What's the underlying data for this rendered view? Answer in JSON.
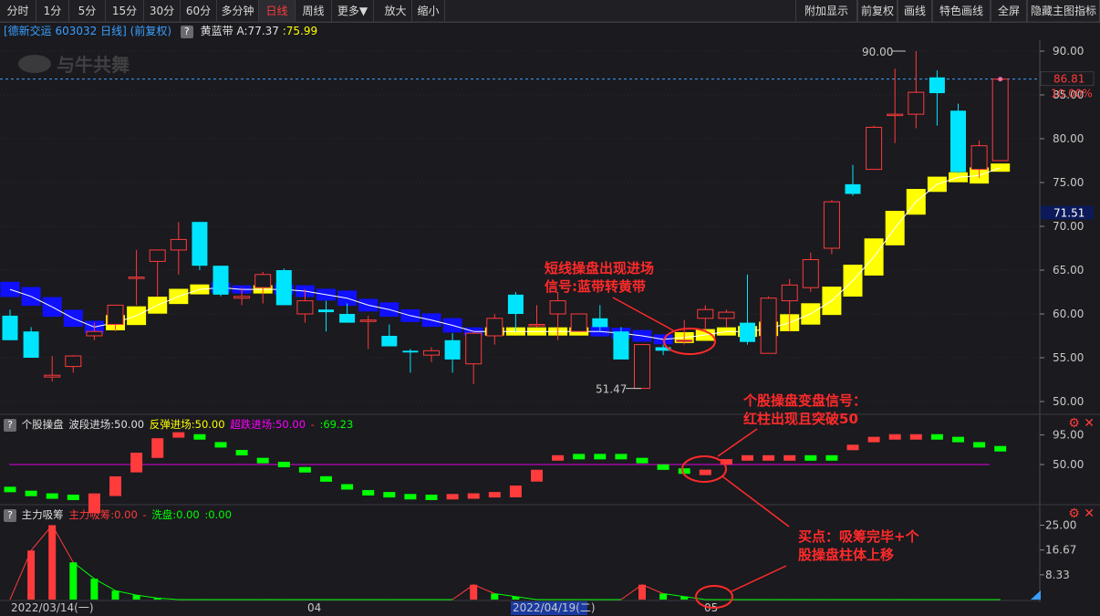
{
  "toolbar": {
    "left": [
      "分时",
      "1分",
      "5分",
      "15分",
      "30分",
      "60分",
      "多分钟",
      "日线",
      "周线",
      "更多▼",
      "放大",
      "缩小"
    ],
    "active": "日线",
    "right": [
      "附加显示",
      "前复权",
      "画线",
      "特色画线",
      "全屏",
      "隐藏主图指标"
    ]
  },
  "infobar": {
    "stock": "[德新交运 603032 日线]",
    "adj": "(前复权)",
    "q": "?",
    "indicator": "黄蓝带",
    "a_label": "A:77.37",
    "b_label": ":75.99"
  },
  "price_axis": {
    "ticks": [
      "90.00",
      "85.00",
      "80.00",
      "75.00",
      "70.00",
      "65.00",
      "60.00",
      "55.00",
      "50.00"
    ],
    "current": "86.81",
    "pct": "10.00%",
    "ma": "71.51"
  },
  "price_labels": {
    "high": "90.00",
    "low": "51.47"
  },
  "annotations": {
    "a1_line1": "短线操盘出现进场",
    "a1_line2": "信号:蓝带转黄带",
    "a2_line1": "个股操盘变盘信号：",
    "a2_line2": "红柱出现且突破50",
    "a3_line1": "买点：吸筹完毕+个",
    "a3_line2": "股操盘柱体上移"
  },
  "panel2": {
    "q": "?",
    "name": "个股操盘",
    "l1": "波段进场:50.00",
    "l2": "反弹进场:50.00",
    "l3": "超跌进场:50.00",
    "l4": "-",
    "l5": ":69.23",
    "ticks": [
      "95.00",
      "50.00"
    ]
  },
  "panel3": {
    "q": "?",
    "name": "主力吸筹",
    "l1": "主力吸筹:0.00",
    "l2": "-",
    "l3": "洗盘:0.00",
    "l4": ":0.00",
    "ticks": [
      "25.00",
      "16.67",
      "8.33"
    ]
  },
  "dates": [
    "2022/03/14(一)",
    "04",
    "2022/04/19(二)",
    "05"
  ],
  "colors": {
    "up": "#ff3b3b",
    "down": "#00e5ff",
    "yellow_band": "#ffff00",
    "blue_band": "#1010ff",
    "ma": "#ffffff",
    "bg": "#1a1a1f",
    "grid": "#2a2a30",
    "magenta": "#e000e0",
    "green": "#00ff00"
  },
  "chart_data": [
    {
      "type": "candlestick",
      "title": "德新交运 603032 日线",
      "ylim": [
        50,
        90
      ],
      "candles": [
        {
          "o": 59.8,
          "h": 60.5,
          "l": 57.0,
          "c": 57.0
        },
        {
          "o": 58.0,
          "h": 58.5,
          "l": 55.0,
          "c": 55.0
        },
        {
          "o": 52.8,
          "h": 55.2,
          "l": 52.3,
          "c": 53.0
        },
        {
          "o": 54.0,
          "h": 55.3,
          "l": 53.3,
          "c": 55.2
        },
        {
          "o": 57.5,
          "h": 59.0,
          "l": 57.0,
          "c": 58.0
        },
        {
          "o": 58.8,
          "h": 61.0,
          "l": 58.0,
          "c": 61.0
        },
        {
          "o": 64.2,
          "h": 67.3,
          "l": 61.0,
          "c": 64.2
        },
        {
          "o": 66.0,
          "h": 67.3,
          "l": 62.0,
          "c": 67.3
        },
        {
          "o": 67.3,
          "h": 70.5,
          "l": 64.5,
          "c": 68.5
        },
        {
          "o": 70.5,
          "h": 70.5,
          "l": 65.0,
          "c": 65.5
        },
        {
          "o": 65.5,
          "h": 65.5,
          "l": 62.0,
          "c": 62.2
        },
        {
          "o": 61.8,
          "h": 63.0,
          "l": 61.0,
          "c": 62.0
        },
        {
          "o": 63.0,
          "h": 64.8,
          "l": 61.2,
          "c": 64.5
        },
        {
          "o": 65.0,
          "h": 65.2,
          "l": 61.0,
          "c": 61.0
        },
        {
          "o": 60.0,
          "h": 62.8,
          "l": 59.0,
          "c": 61.5
        },
        {
          "o": 60.5,
          "h": 61.5,
          "l": 58.0,
          "c": 60.2
        },
        {
          "o": 60.0,
          "h": 61.2,
          "l": 59.0,
          "c": 59.0
        },
        {
          "o": 59.3,
          "h": 59.8,
          "l": 56.0,
          "c": 59.3
        },
        {
          "o": 57.5,
          "h": 58.8,
          "l": 56.3,
          "c": 56.3
        },
        {
          "o": 55.8,
          "h": 56.0,
          "l": 53.3,
          "c": 55.6
        },
        {
          "o": 55.3,
          "h": 56.2,
          "l": 54.5,
          "c": 55.8
        },
        {
          "o": 57.0,
          "h": 57.8,
          "l": 53.3,
          "c": 54.8
        },
        {
          "o": 54.3,
          "h": 58.0,
          "l": 52.0,
          "c": 57.8
        },
        {
          "o": 57.5,
          "h": 60.0,
          "l": 56.5,
          "c": 59.5
        },
        {
          "o": 62.2,
          "h": 62.5,
          "l": 58.0,
          "c": 60.0
        },
        {
          "o": 58.8,
          "h": 61.0,
          "l": 58.5,
          "c": 58.8
        },
        {
          "o": 60.0,
          "h": 62.5,
          "l": 57.0,
          "c": 61.5
        },
        {
          "o": 58.0,
          "h": 60.0,
          "l": 58.0,
          "c": 60.0
        },
        {
          "o": 59.5,
          "h": 61.0,
          "l": 58.0,
          "c": 58.5
        },
        {
          "o": 58.0,
          "h": 58.5,
          "l": 54.8,
          "c": 54.8
        },
        {
          "o": 51.5,
          "h": 56.5,
          "l": 51.5,
          "c": 56.5
        },
        {
          "o": 56.2,
          "h": 56.5,
          "l": 55.3,
          "c": 55.8
        },
        {
          "o": 57.0,
          "h": 59.3,
          "l": 56.5,
          "c": 57.0
        },
        {
          "o": 59.5,
          "h": 61.0,
          "l": 58.0,
          "c": 60.5
        },
        {
          "o": 59.5,
          "h": 60.5,
          "l": 58.5,
          "c": 60.2
        },
        {
          "o": 59.0,
          "h": 64.5,
          "l": 56.5,
          "c": 56.8
        },
        {
          "o": 55.5,
          "h": 62.0,
          "l": 55.5,
          "c": 61.8
        },
        {
          "o": 61.5,
          "h": 64.0,
          "l": 58.0,
          "c": 63.3
        },
        {
          "o": 63.0,
          "h": 67.0,
          "l": 62.5,
          "c": 66.2
        },
        {
          "o": 67.5,
          "h": 73.0,
          "l": 66.8,
          "c": 72.8
        },
        {
          "o": 74.8,
          "h": 77.0,
          "l": 73.5,
          "c": 73.7
        },
        {
          "o": 76.5,
          "h": 81.5,
          "l": 76.5,
          "c": 81.3
        },
        {
          "o": 82.8,
          "h": 88.0,
          "l": 79.5,
          "c": 82.8
        },
        {
          "o": 82.8,
          "h": 90.0,
          "l": 81.2,
          "c": 85.3
        },
        {
          "o": 87.0,
          "h": 87.8,
          "l": 81.5,
          "c": 85.2
        },
        {
          "o": 83.2,
          "h": 84.0,
          "l": 76.0,
          "c": 76.2
        },
        {
          "o": 76.5,
          "h": 79.8,
          "l": 75.5,
          "c": 79.2
        },
        {
          "o": 77.5,
          "h": 86.8,
          "l": 77.5,
          "c": 86.8
        }
      ],
      "band": [
        {
          "v": 62.8,
          "c": "blue"
        },
        {
          "v": 62.0,
          "c": "blue"
        },
        {
          "v": 60.8,
          "c": "blue"
        },
        {
          "v": 59.5,
          "c": "blue"
        },
        {
          "v": 58.5,
          "c": "blue"
        },
        {
          "v": 59.0,
          "c": "yellow"
        },
        {
          "v": 59.8,
          "c": "yellow"
        },
        {
          "v": 61.0,
          "c": "yellow"
        },
        {
          "v": 62.0,
          "c": "yellow"
        },
        {
          "v": 62.8,
          "c": "yellow"
        },
        {
          "v": 63.0,
          "c": "blue"
        },
        {
          "v": 62.8,
          "c": "blue"
        },
        {
          "v": 62.8,
          "c": "yellow"
        },
        {
          "v": 62.8,
          "c": "blue"
        },
        {
          "v": 62.6,
          "c": "blue"
        },
        {
          "v": 62.2,
          "c": "blue"
        },
        {
          "v": 61.8,
          "c": "blue"
        },
        {
          "v": 61.0,
          "c": "blue"
        },
        {
          "v": 60.5,
          "c": "blue"
        },
        {
          "v": 59.8,
          "c": "blue"
        },
        {
          "v": 59.3,
          "c": "blue"
        },
        {
          "v": 58.7,
          "c": "blue"
        },
        {
          "v": 58.0,
          "c": "blue"
        },
        {
          "v": 58.0,
          "c": "yellow"
        },
        {
          "v": 58.0,
          "c": "yellow"
        },
        {
          "v": 58.0,
          "c": "yellow"
        },
        {
          "v": 58.0,
          "c": "yellow"
        },
        {
          "v": 58.0,
          "c": "yellow"
        },
        {
          "v": 58.0,
          "c": "blue"
        },
        {
          "v": 57.8,
          "c": "blue"
        },
        {
          "v": 57.5,
          "c": "blue"
        },
        {
          "v": 57.1,
          "c": "blue"
        },
        {
          "v": 57.3,
          "c": "yellow"
        },
        {
          "v": 57.6,
          "c": "yellow"
        },
        {
          "v": 58.0,
          "c": "yellow"
        },
        {
          "v": 58.0,
          "c": "yellow"
        },
        {
          "v": 58.3,
          "c": "yellow"
        },
        {
          "v": 59.0,
          "c": "yellow"
        },
        {
          "v": 60.0,
          "c": "yellow"
        },
        {
          "v": 61.5,
          "c": "yellow"
        },
        {
          "v": 63.8,
          "c": "yellow"
        },
        {
          "v": 66.5,
          "c": "yellow"
        },
        {
          "v": 69.8,
          "c": "yellow"
        },
        {
          "v": 72.8,
          "c": "yellow"
        },
        {
          "v": 74.8,
          "c": "yellow"
        },
        {
          "v": 75.6,
          "c": "yellow"
        },
        {
          "v": 75.8,
          "c": "yellow"
        },
        {
          "v": 76.7,
          "c": "yellow"
        }
      ]
    },
    {
      "type": "bar",
      "title": "个股操盘",
      "ylim": [
        0,
        100
      ],
      "values": [
        {
          "v": 12,
          "c": "green"
        },
        {
          "v": 6,
          "c": "green"
        },
        {
          "v": 2,
          "c": "green"
        },
        {
          "v": 0,
          "c": "green"
        },
        {
          "v": 6,
          "c": "red"
        },
        {
          "v": 32,
          "c": "red"
        },
        {
          "v": 68,
          "c": "red"
        },
        {
          "v": 90,
          "c": "red"
        },
        {
          "v": 95,
          "c": "red"
        },
        {
          "v": 92,
          "c": "green"
        },
        {
          "v": 80,
          "c": "green"
        },
        {
          "v": 68,
          "c": "green"
        },
        {
          "v": 56,
          "c": "green"
        },
        {
          "v": 50,
          "c": "green"
        },
        {
          "v": 42,
          "c": "green"
        },
        {
          "v": 28,
          "c": "green"
        },
        {
          "v": 16,
          "c": "green"
        },
        {
          "v": 7,
          "c": "green"
        },
        {
          "v": 4,
          "c": "green"
        },
        {
          "v": 1,
          "c": "green"
        },
        {
          "v": 0,
          "c": "green"
        },
        {
          "v": 1,
          "c": "red"
        },
        {
          "v": 2,
          "c": "red"
        },
        {
          "v": 4,
          "c": "red"
        },
        {
          "v": 18,
          "c": "red"
        },
        {
          "v": 42,
          "c": "red"
        },
        {
          "v": 60,
          "c": "red"
        },
        {
          "v": 62,
          "c": "green"
        },
        {
          "v": 62,
          "c": "green"
        },
        {
          "v": 62,
          "c": "green"
        },
        {
          "v": 56,
          "c": "green"
        },
        {
          "v": 46,
          "c": "green"
        },
        {
          "v": 40,
          "c": "green"
        },
        {
          "v": 38,
          "c": "red"
        },
        {
          "v": 54,
          "c": "red"
        },
        {
          "v": 60,
          "c": "red"
        },
        {
          "v": 60,
          "c": "red"
        },
        {
          "v": 60,
          "c": "red"
        },
        {
          "v": 60,
          "c": "green"
        },
        {
          "v": 60,
          "c": "green"
        },
        {
          "v": 76,
          "c": "red"
        },
        {
          "v": 88,
          "c": "red"
        },
        {
          "v": 92,
          "c": "red"
        },
        {
          "v": 92,
          "c": "red"
        },
        {
          "v": 92,
          "c": "green"
        },
        {
          "v": 88,
          "c": "green"
        },
        {
          "v": 80,
          "c": "green"
        },
        {
          "v": 74,
          "c": "green"
        }
      ]
    },
    {
      "type": "bar",
      "title": "主力吸筹",
      "ylim": [
        0,
        25
      ],
      "values": [
        {
          "v": 0,
          "c": "red"
        },
        {
          "v": 16.5,
          "c": "red"
        },
        {
          "v": 25,
          "c": "red"
        },
        {
          "v": 12.5,
          "c": "green"
        },
        {
          "v": 7,
          "c": "green"
        },
        {
          "v": 3,
          "c": "green"
        },
        {
          "v": 1.5,
          "c": "green"
        },
        {
          "v": 0.5,
          "c": "green"
        },
        {
          "v": 0,
          "c": "green"
        },
        {
          "v": 0,
          "c": "green"
        },
        {
          "v": 0,
          "c": "green"
        },
        {
          "v": 0,
          "c": "green"
        },
        {
          "v": 0,
          "c": "green"
        },
        {
          "v": 0,
          "c": "green"
        },
        {
          "v": 0,
          "c": "green"
        },
        {
          "v": 0,
          "c": "green"
        },
        {
          "v": 0,
          "c": "green"
        },
        {
          "v": 0,
          "c": "green"
        },
        {
          "v": 0,
          "c": "green"
        },
        {
          "v": 0,
          "c": "green"
        },
        {
          "v": 0,
          "c": "green"
        },
        {
          "v": 0,
          "c": "green"
        },
        {
          "v": 5,
          "c": "red"
        },
        {
          "v": 2,
          "c": "green"
        },
        {
          "v": 1,
          "c": "green"
        },
        {
          "v": 0,
          "c": "green"
        },
        {
          "v": 0,
          "c": "green"
        },
        {
          "v": 0,
          "c": "green"
        },
        {
          "v": 0,
          "c": "green"
        },
        {
          "v": 0,
          "c": "green"
        },
        {
          "v": 5,
          "c": "red"
        },
        {
          "v": 2,
          "c": "green"
        },
        {
          "v": 1,
          "c": "green"
        },
        {
          "v": 0,
          "c": "green"
        },
        {
          "v": 0,
          "c": "green"
        },
        {
          "v": 0,
          "c": "green"
        },
        {
          "v": 0,
          "c": "green"
        },
        {
          "v": 0,
          "c": "green"
        },
        {
          "v": 0,
          "c": "green"
        },
        {
          "v": 0,
          "c": "green"
        },
        {
          "v": 0,
          "c": "green"
        },
        {
          "v": 0,
          "c": "green"
        },
        {
          "v": 0,
          "c": "green"
        },
        {
          "v": 0,
          "c": "green"
        },
        {
          "v": 0,
          "c": "green"
        },
        {
          "v": 0,
          "c": "green"
        },
        {
          "v": 0,
          "c": "green"
        },
        {
          "v": 0,
          "c": "green"
        }
      ]
    }
  ]
}
